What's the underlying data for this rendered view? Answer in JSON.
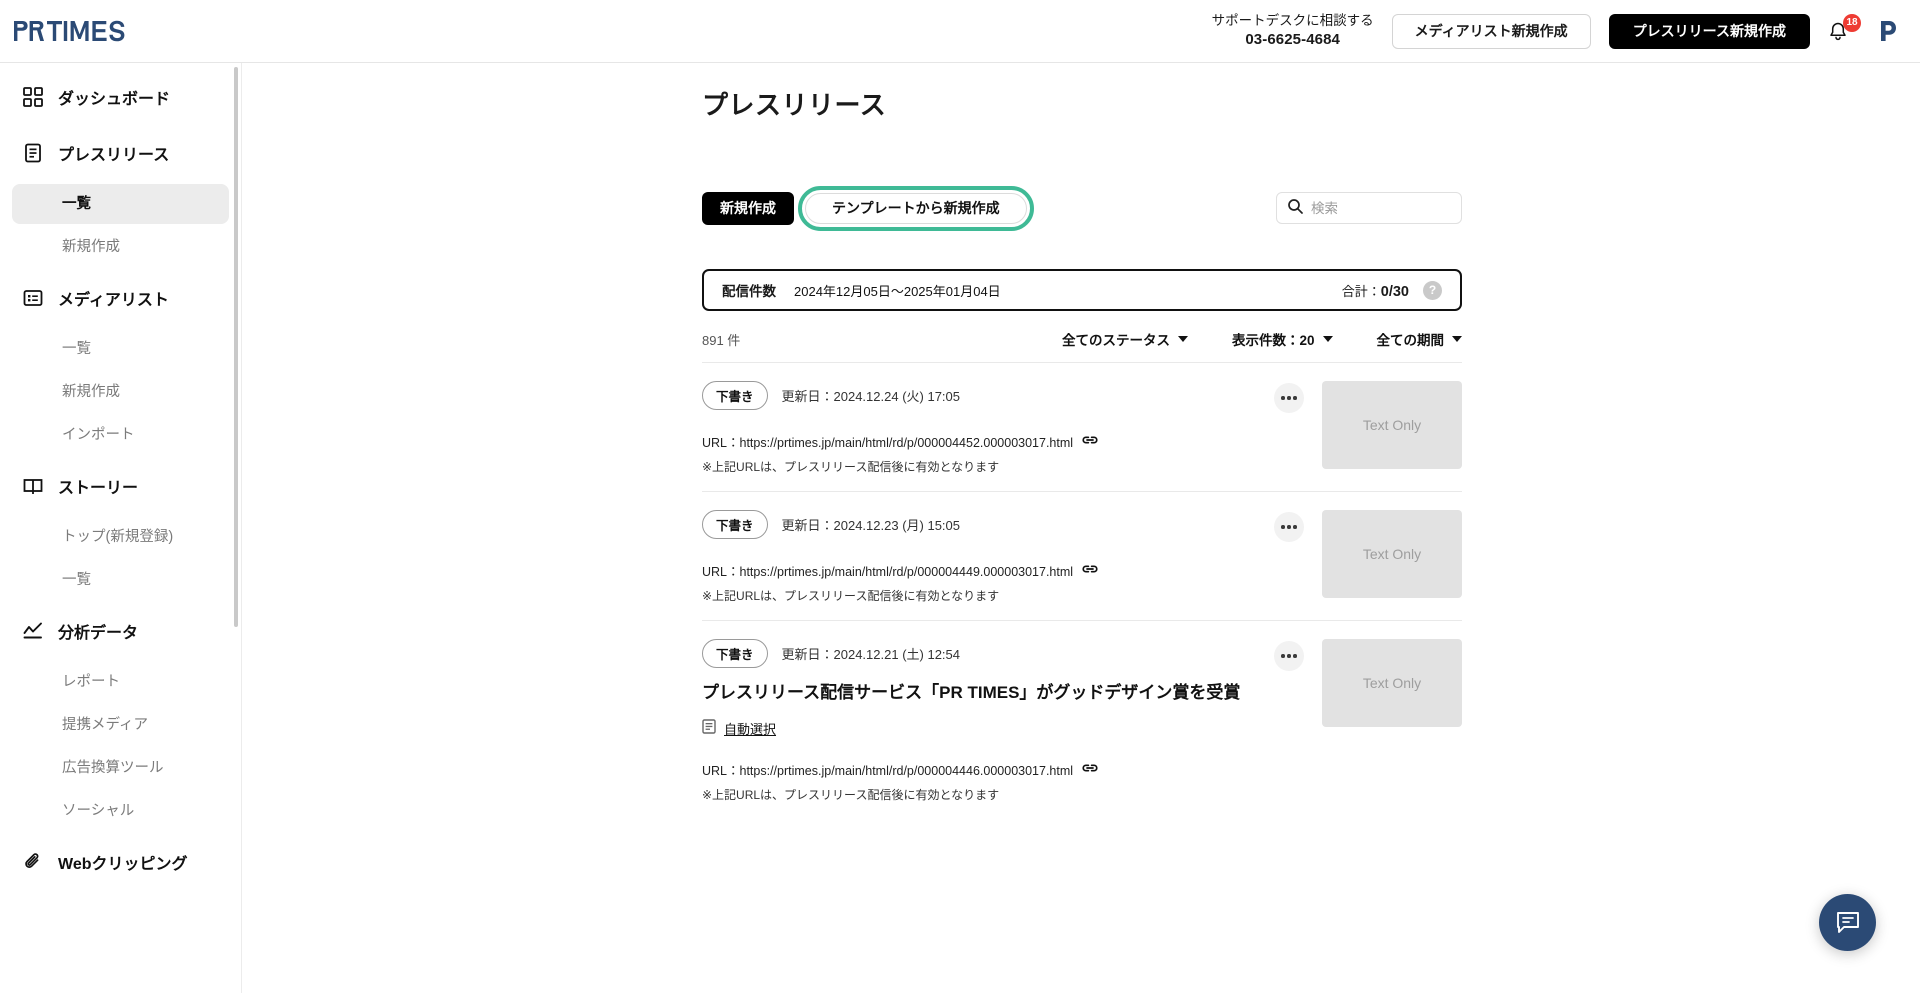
{
  "header": {
    "logo_text": "PR TIMES",
    "support_line1": "サポートデスクに相談する",
    "support_phone": "03-6625-4684",
    "btn_medialist": "メディアリスト新規作成",
    "btn_newrelease": "プレスリリース新規作成",
    "notification_count": "18",
    "avatar_letter": "P"
  },
  "sidebar": {
    "groups": [
      {
        "label": "ダッシュボード",
        "icon": "dashboard-icon",
        "items": []
      },
      {
        "label": "プレスリリース",
        "icon": "document-icon",
        "items": [
          {
            "label": "一覧",
            "active": true
          },
          {
            "label": "新規作成",
            "active": false
          }
        ]
      },
      {
        "label": "メディアリスト",
        "icon": "list-card-icon",
        "items": [
          {
            "label": "一覧",
            "active": false
          },
          {
            "label": "新規作成",
            "active": false
          },
          {
            "label": "インポート",
            "active": false
          }
        ]
      },
      {
        "label": "ストーリー",
        "icon": "book-icon",
        "items": [
          {
            "label": "トップ(新規登録)",
            "active": false
          },
          {
            "label": "一覧",
            "active": false
          }
        ]
      },
      {
        "label": "分析データ",
        "icon": "analytics-icon",
        "items": [
          {
            "label": "レポート",
            "active": false
          },
          {
            "label": "提携メディア",
            "active": false
          },
          {
            "label": "広告換算ツール",
            "active": false
          },
          {
            "label": "ソーシャル",
            "active": false
          }
        ]
      },
      {
        "label": "Webクリッピング",
        "icon": "paperclip-icon",
        "items": []
      }
    ]
  },
  "main": {
    "page_title": "プレスリリース",
    "btn_new": "新規作成",
    "btn_template": "テンプレートから新規作成",
    "search_placeholder": "検索",
    "search_value": "",
    "stats": {
      "label": "配信件数",
      "range": "2024年12月05日〜2025年01月04日",
      "total_label": "合計：",
      "total_value": "0/30",
      "help_glyph": "?"
    },
    "filter": {
      "count": "891 件",
      "status": "全てのステータス",
      "per_page": "表示件数：20",
      "period": "全ての期間"
    },
    "releases": [
      {
        "status": "下書き",
        "date": "更新日：2024.12.24 (火) 17:05",
        "title": "",
        "auto_select": "",
        "url": "URL：https://prtimes.jp/main/html/rd/p/000004452.000003017.html",
        "note": "※上記URLは、プレスリリース配信後に有効となります",
        "thumb": "Text Only"
      },
      {
        "status": "下書き",
        "date": "更新日：2024.12.23 (月) 15:05",
        "title": "",
        "auto_select": "",
        "url": "URL：https://prtimes.jp/main/html/rd/p/000004449.000003017.html",
        "note": "※上記URLは、プレスリリース配信後に有効となります",
        "thumb": "Text Only"
      },
      {
        "status": "下書き",
        "date": "更新日：2024.12.21 (土) 12:54",
        "title": "プレスリリース配信サービス「PR TIMES」がグッドデザイン賞を受賞",
        "auto_select": "自動選択",
        "url": "URL：https://prtimes.jp/main/html/rd/p/000004446.000003017.html",
        "note": "※上記URLは、プレスリリース配信後に有効となります",
        "thumb": "Text Only"
      }
    ]
  },
  "fab": {
    "icon": "chat-bubble-icon"
  },
  "colors": {
    "brand_navy": "#2B4A75",
    "accent_green": "#3FBA96",
    "badge_red": "#EE3B33",
    "dark_button": "#000000"
  }
}
